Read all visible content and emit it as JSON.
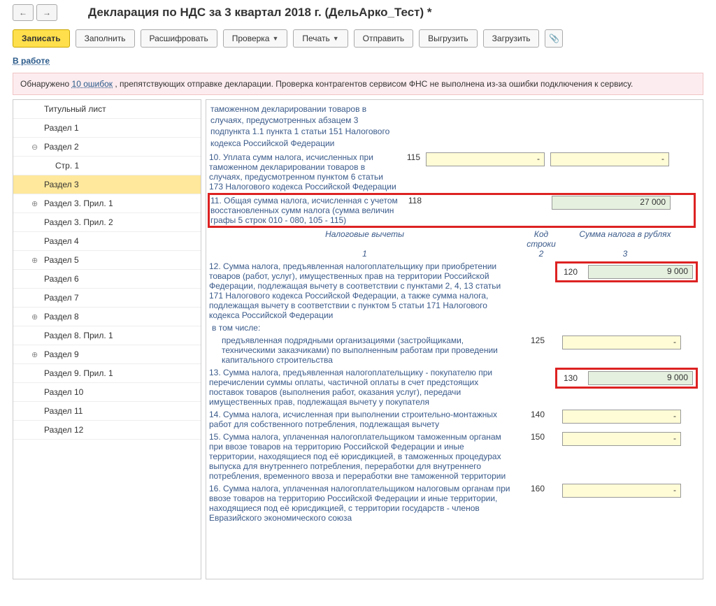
{
  "title": "Декларация по НДС за 3 квартал 2018 г. (ДельАрко_Тест) *",
  "toolbar": {
    "back": "←",
    "fwd": "→",
    "write": "Записать",
    "fill": "Заполнить",
    "decode": "Расшифровать",
    "check": "Проверка",
    "print": "Печать",
    "send": "Отправить",
    "export": "Выгрузить",
    "import": "Загрузить"
  },
  "status": "В работе",
  "errorbar": {
    "pfx": "Обнаружено ",
    "link": "10 ошибок",
    "sfx": ", препятствующих отправке декларации. Проверка контрагентов сервисом ФНС не выполнена из-за ошибки подключения к сервису."
  },
  "sidebar": [
    {
      "label": "Титульный лист",
      "mark": ""
    },
    {
      "label": "Раздел 1",
      "mark": ""
    },
    {
      "label": "Раздел 2",
      "mark": "⊖"
    },
    {
      "label": "Стр. 1",
      "mark": "",
      "indent": true
    },
    {
      "label": "Раздел 3",
      "mark": "",
      "active": true
    },
    {
      "label": "Раздел 3. Прил. 1",
      "mark": "⊕"
    },
    {
      "label": "Раздел 3. Прил. 2",
      "mark": ""
    },
    {
      "label": "Раздел 4",
      "mark": ""
    },
    {
      "label": "Раздел 5",
      "mark": "⊕"
    },
    {
      "label": "Раздел 6",
      "mark": ""
    },
    {
      "label": "Раздел 7",
      "mark": ""
    },
    {
      "label": "Раздел 8",
      "mark": "⊕"
    },
    {
      "label": "Раздел 8. Прил. 1",
      "mark": ""
    },
    {
      "label": "Раздел 9",
      "mark": "⊕"
    },
    {
      "label": "Раздел 9. Прил. 1",
      "mark": ""
    },
    {
      "label": "Раздел 10",
      "mark": ""
    },
    {
      "label": "Раздел 11",
      "mark": ""
    },
    {
      "label": "Раздел 12",
      "mark": ""
    }
  ],
  "pre_text": "таможенном декларировании товаров в случаях, предусмотренных абзацем 3 подпункта 1.1 пункта 1 статьи 151 Налогового кодекса Российской Федерации",
  "row10": {
    "desc": "10. Уплата сумм налога, исчисленных при таможенном декларировании товаров в случаях, предусмотренном пунктом 6 статьи 173 Налогового кодекса Российской Федерации",
    "code": "115"
  },
  "row11": {
    "desc": "11. Общая сумма налога, исчисленная с учетом восстановленных сумм налога (сумма величин графы 5 строк 010 - 080, 105 - 115)",
    "code": "118",
    "value": "27 000"
  },
  "hdr_section": "Налоговые вычеты",
  "hdr_cols": {
    "h2": "Код строки",
    "h3": "Сумма налога в рублях"
  },
  "hdr_nums": {
    "n1": "1",
    "n2": "2",
    "n3": "3"
  },
  "row12": {
    "desc": "12. Сумма налога, предъявленная налогоплательщику при приобретении товаров (работ, услуг), имущественных прав на территории Российской Федерации, подлежащая вычету в соответствии с пунктами 2, 4, 13 статьи 171 Налогового кодекса Российской Федерации, а также сумма налога, подлежащая вычету в соответствии с пунктом 5 статьи 171 Налогового кодекса Российской Федерации",
    "code": "120",
    "value": "9 000"
  },
  "incl": "в том числе:",
  "row12a": {
    "desc": "предъявленная подрядными организациями (застройщиками, техническими заказчиками) по выполненным работам при проведении капитального строительства",
    "code": "125"
  },
  "row13": {
    "desc": "13. Сумма налога, предъявленная налогоплательщику - покупателю при перечислении суммы оплаты, частичной оплаты в счет предстоящих поставок товаров (выполнения работ, оказания услуг), передачи имущественных прав, подлежащая вычету у покупателя",
    "code": "130",
    "value": "9 000"
  },
  "row14": {
    "desc": "14. Сумма налога, исчисленная при выполнении строительно-монтажных работ для собственного потребления, подлежащая вычету",
    "code": "140"
  },
  "row15": {
    "desc": "15. Сумма налога, уплаченная налогоплательщиком таможенным органам при ввозе товаров на территорию Российской Федерации и иные территории, находящиеся под её юрисдикцией, в таможенных процедурах выпуска для внутреннего потребления, переработки для внутреннего потребления, временного ввоза и переработки вне таможенной территории",
    "code": "150"
  },
  "row16": {
    "desc": "16. Сумма налога, уплаченная налогоплательщиком налоговым органам при ввозе товаров на территорию Российской Федерации и иные территории, находящиеся под её юрисдикцией, с территории государств - членов Евразийского экономического союза",
    "code": "160"
  }
}
